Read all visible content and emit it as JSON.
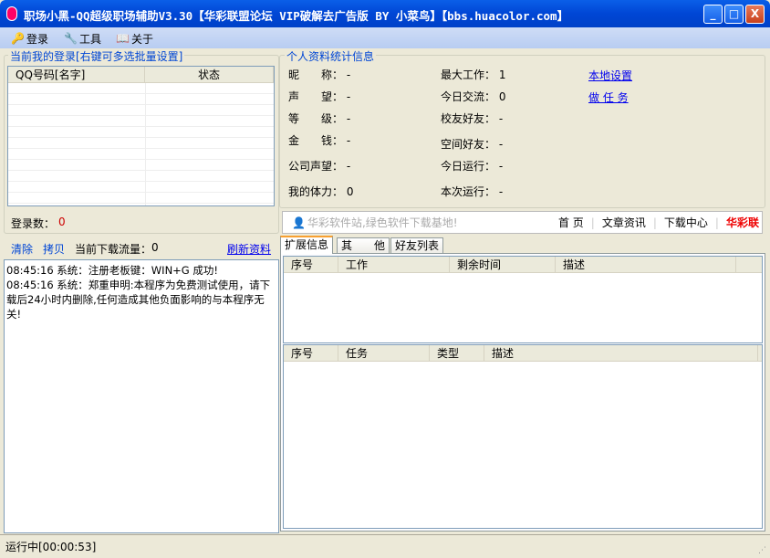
{
  "window": {
    "title": "职场小黑-QQ超级职场辅助V3.30【华彩联盟论坛 VIP破解去广告版 BY 小菜鸟】【bbs.huacolor.com】",
    "minimize": "_",
    "maximize": "□",
    "close": "X"
  },
  "menu": [
    {
      "label": "登录",
      "icon": "key-icon"
    },
    {
      "label": "工具",
      "icon": "wrench-icon"
    },
    {
      "label": "关于",
      "icon": "book-icon"
    }
  ],
  "login_group": {
    "title": "当前我的登录[右键可多选批量设置]",
    "columns": [
      "QQ号码[名字]",
      "状态"
    ],
    "count_label": "登录数：",
    "count": "0"
  },
  "log_toolbar": {
    "clear": "清除",
    "copy": "拷贝",
    "traffic_label": "当前下载流量：",
    "traffic": "0",
    "refresh": "刷新资料"
  },
  "log": [
    "08:45:16 系统：注册老板键：WIN+G 成功!",
    "08:45:16 系统：郑重申明:本程序为免费测试使用，请下载后24小时内删除,任何造成其他负面影响的与本程序无关!"
  ],
  "profile": {
    "title": "个人资料统计信息",
    "left": [
      {
        "label": "昵　　称：",
        "value": "-"
      },
      {
        "label": "声　　望：",
        "value": "-"
      },
      {
        "label": "等　　级：",
        "value": "-"
      },
      {
        "label": "金　　钱：",
        "value": "-"
      },
      {
        "label": "公司声望：",
        "value": "-"
      },
      {
        "label": "我的体力：",
        "value": "0"
      }
    ],
    "mid": [
      {
        "label": "最大工作：",
        "value": "1"
      },
      {
        "label": "今日交流：",
        "value": "0"
      },
      {
        "label": "校友好友：",
        "value": "-"
      },
      {
        "label": "空间好友：",
        "value": "-"
      },
      {
        "label": "今日运行：",
        "value": "-"
      },
      {
        "label": "本次运行：",
        "value": "-"
      }
    ],
    "links": [
      "本地设置",
      "做 任 务"
    ]
  },
  "adbar": {
    "text": "华彩软件站,绿色软件下载基地!",
    "links": [
      "首 页",
      "文章资讯",
      "下载中心"
    ],
    "brand": "华彩联"
  },
  "tabs": [
    "扩展信息",
    "其　　他",
    "好友列表"
  ],
  "grid1": {
    "columns": [
      "序号",
      "工作",
      "剩余时间",
      "描述"
    ]
  },
  "grid2": {
    "columns": [
      "序号",
      "任务",
      "类型",
      "描述"
    ]
  },
  "status": "运行中[00:00:53]"
}
